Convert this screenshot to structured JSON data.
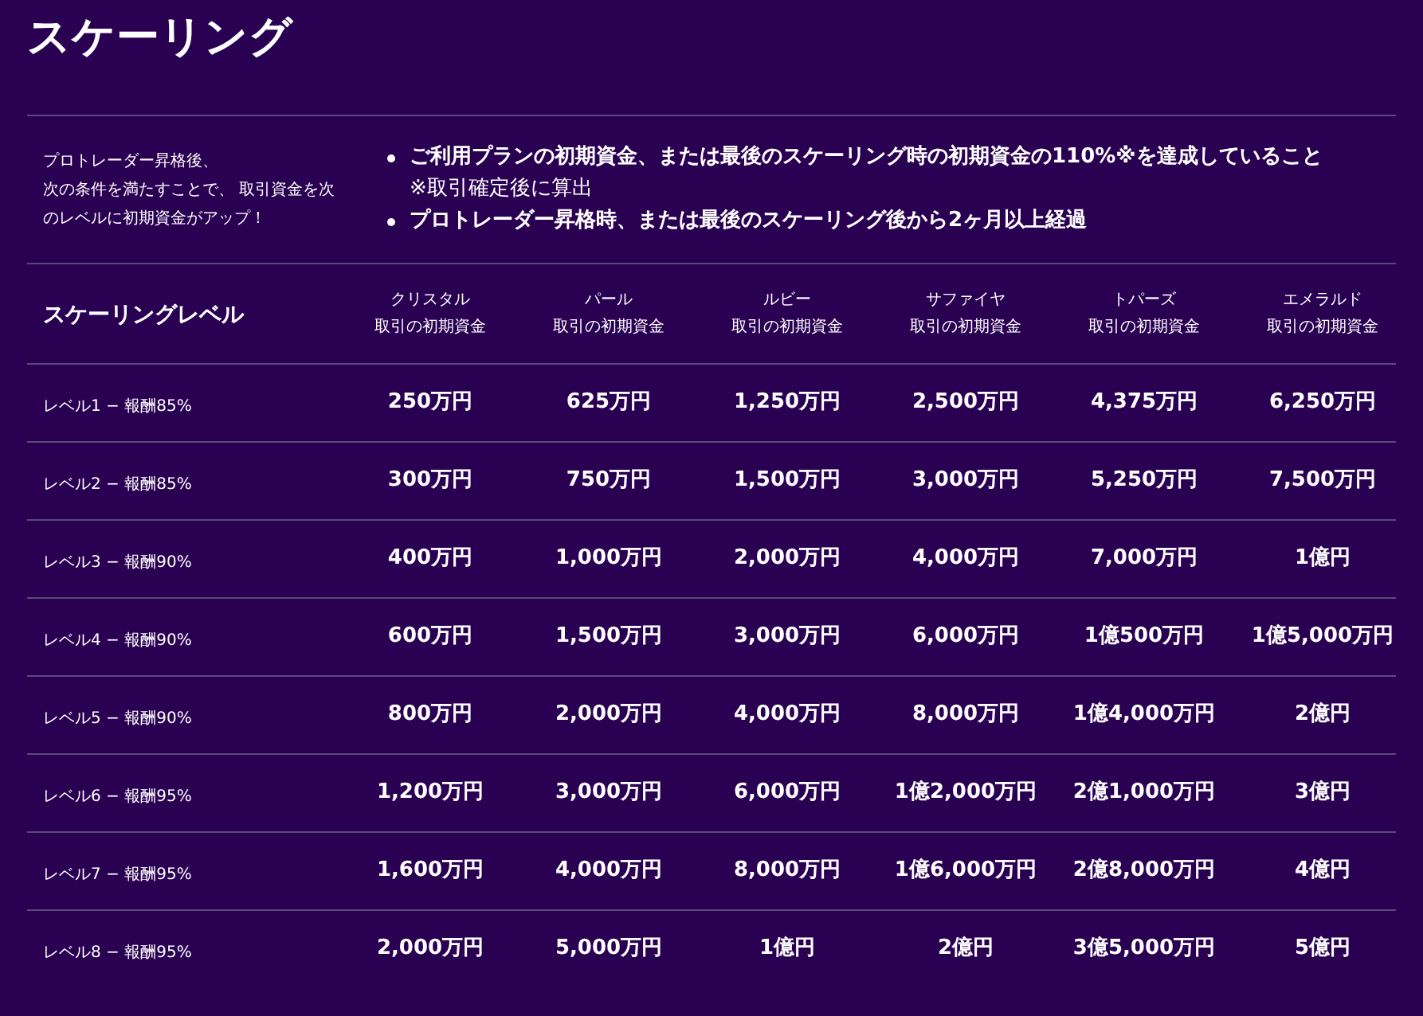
{
  "title": "スケーリング",
  "intro": {
    "description": [
      "プロトレーダー昇格後、",
      "次の条件を満たすことで、 取引資金を次のレベルに初期資金がアップ！"
    ],
    "conditions": [
      {
        "text": "ご利用プランの初期資金、または最後のスケーリング時の初期資金の110%※を達成していること",
        "note": "※取引確定後に算出"
      },
      {
        "text": "プロトレーダー昇格時、または最後のスケーリング後から2ヶ月以上経過"
      }
    ]
  },
  "table": {
    "columns": [
      {
        "name": "スケーリングレベル"
      },
      {
        "name": "クリスタル",
        "sub": "取引の初期資金"
      },
      {
        "name": "パール",
        "sub": "取引の初期資金"
      },
      {
        "name": "ルビー",
        "sub": "取引の初期資金"
      },
      {
        "name": "サファイヤ",
        "sub": "取引の初期資金"
      },
      {
        "name": "トパーズ",
        "sub": "取引の初期資金"
      },
      {
        "name": "エメラルド",
        "sub": "取引の初期資金"
      }
    ],
    "rows": [
      {
        "cells": [
          "レベル1 − 報酬85%",
          "250万円",
          "625万円",
          "1,250万円",
          "2,500万円",
          "4,375万円",
          "6,250万円"
        ]
      },
      {
        "cells": [
          "レベル2 − 報酬85%",
          "300万円",
          "750万円",
          "1,500万円",
          "3,000万円",
          "5,250万円",
          "7,500万円"
        ]
      },
      {
        "cells": [
          "レベル3 − 報酬90%",
          "400万円",
          "1,000万円",
          "2,000万円",
          "4,000万円",
          "7,000万円",
          "1億円"
        ]
      },
      {
        "cells": [
          "レベル4 − 報酬90%",
          "600万円",
          "1,500万円",
          "3,000万円",
          "6,000万円",
          "1億500万円",
          "1億5,000万円"
        ]
      },
      {
        "cells": [
          "レベル5 − 報酬90%",
          "800万円",
          "2,000万円",
          "4,000万円",
          "8,000万円",
          "1億4,000万円",
          "2億円"
        ]
      },
      {
        "cells": [
          "レベル6 − 報酬95%",
          "1,200万円",
          "3,000万円",
          "6,000万円",
          "1億2,000万円",
          "2億1,000万円",
          "3億円"
        ]
      },
      {
        "cells": [
          "レベル7 − 報酬95%",
          "1,600万円",
          "4,000万円",
          "8,000万円",
          "1億6,000万円",
          "2億8,000万円",
          "4億円"
        ]
      },
      {
        "cells": [
          "レベル8 − 報酬95%",
          "2,000万円",
          "5,000万円",
          "1億円",
          "2億円",
          "3億5,000万円",
          "5億円"
        ]
      }
    ]
  }
}
